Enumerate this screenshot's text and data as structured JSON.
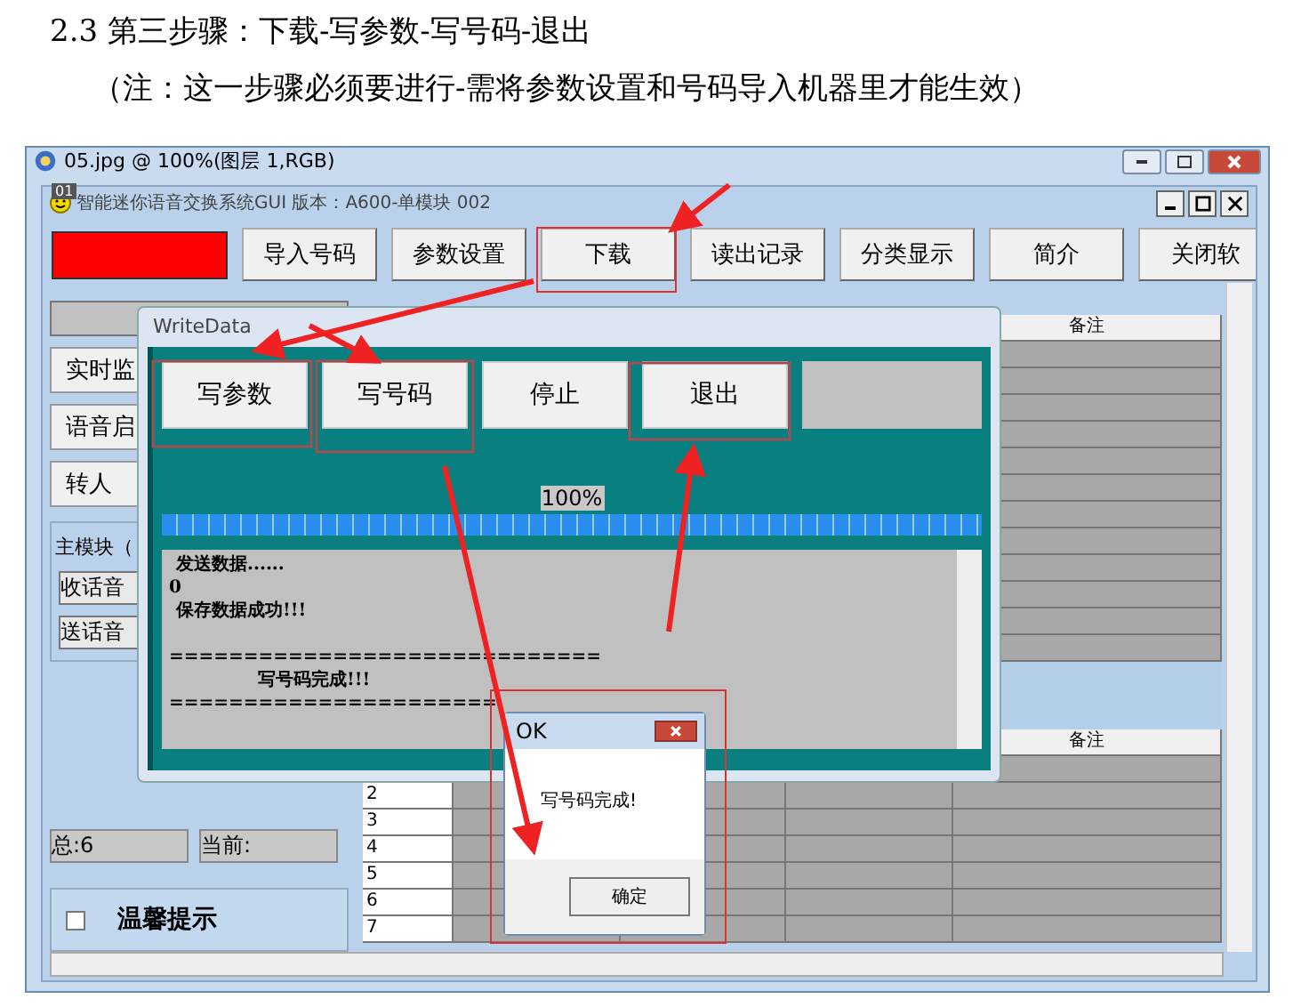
{
  "heading": "2.3 第三步骤：下载-写参数-写号码-退出",
  "note": "（注：这一步骤必须要进行-需将参数设置和号码导入机器里才能生效）",
  "image_window": {
    "title": "05.jpg @ 100%(图层 1,RGB)",
    "tag": "01",
    "app": {
      "title": "智能迷你语音交换系统GUI 版本：A600-单模块 002",
      "toolbar": [
        {
          "label": "导入号码"
        },
        {
          "label": "参数设置"
        },
        {
          "label": "下载"
        },
        {
          "label": "读出记录"
        },
        {
          "label": "分类显示"
        },
        {
          "label": "简介"
        },
        {
          "label": "关闭软"
        }
      ],
      "side_buttons": [
        "实时监",
        "语音启",
        "转人"
      ],
      "group_title": "主模块（",
      "volume_fields": [
        "收话音",
        "送话音"
      ],
      "total": "总:6",
      "current": "当前:",
      "tip": {
        "label": "温馨提示",
        "checked": false
      },
      "upper_table": {
        "last_column": "备注"
      },
      "lower_table": {
        "last_column": "备注",
        "row_numbers": [
          "2",
          "3",
          "4",
          "5",
          "6",
          "7"
        ]
      }
    },
    "write_dialog": {
      "title": "WriteData",
      "buttons": [
        "写参数",
        "写号码",
        "停止",
        "退出"
      ],
      "progress": {
        "reading": "100%",
        "level": 1
      },
      "log": [
        {
          "kind": "text",
          "text": "发送数据......"
        },
        {
          "kind": "code",
          "text": "0"
        },
        {
          "kind": "text",
          "text": "保存数据成功!!!"
        },
        {
          "kind": "blank"
        },
        {
          "kind": "rule",
          "text": "============================="
        },
        {
          "kind": "indent",
          "text": "写号码完成!!!"
        },
        {
          "kind": "rule",
          "text": "======================"
        }
      ]
    },
    "ok_dialog": {
      "title": "OK",
      "message": "写号码完成!",
      "button": "确定"
    }
  }
}
